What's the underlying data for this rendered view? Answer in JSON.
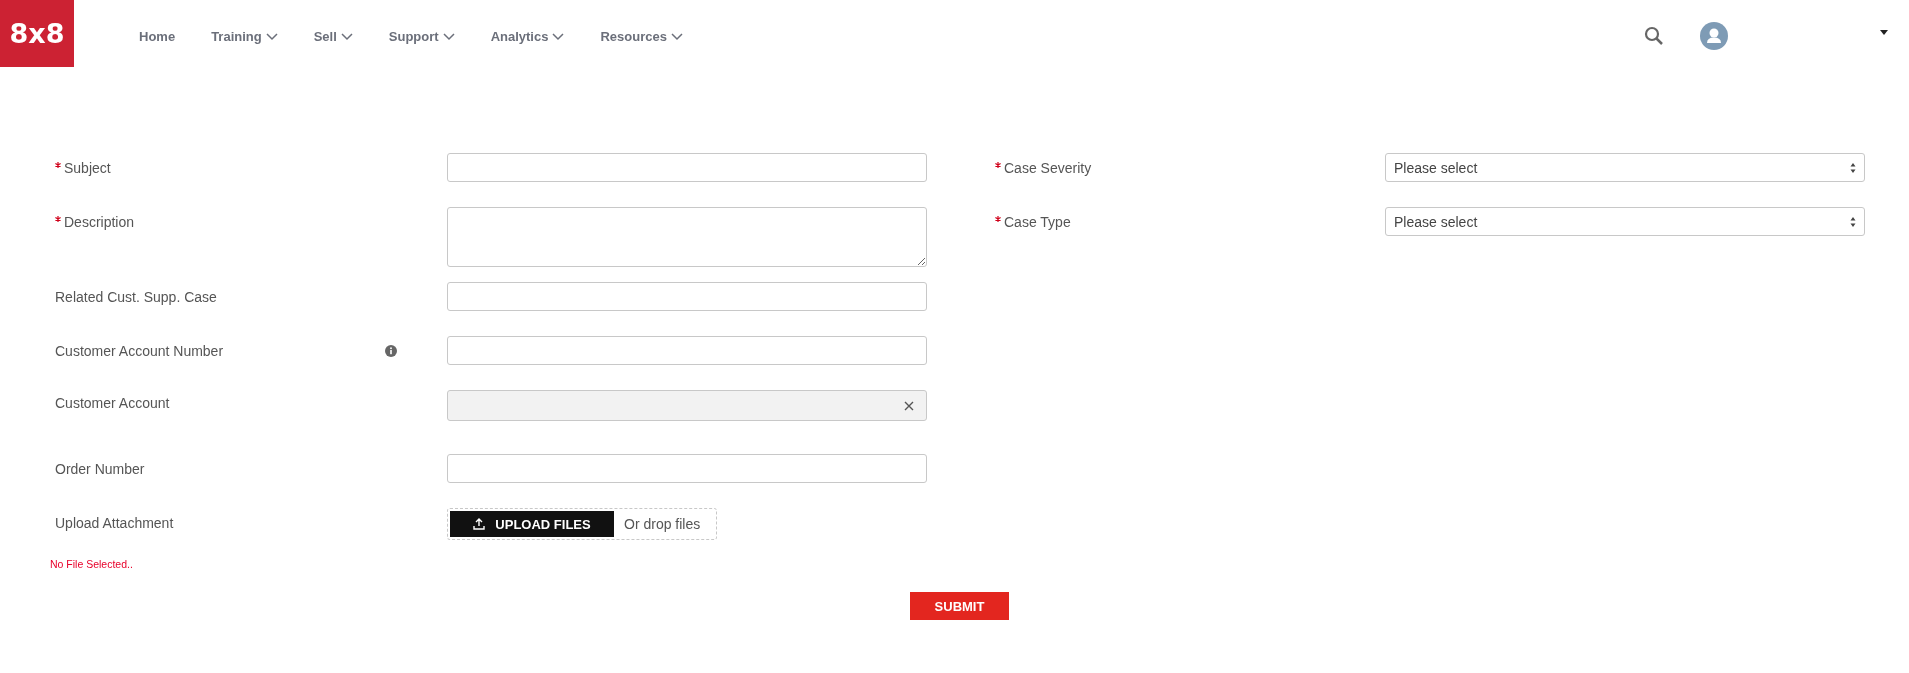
{
  "header": {
    "logo": "8x8",
    "nav": [
      {
        "label": "Home",
        "dropdown": false
      },
      {
        "label": "Training",
        "dropdown": true
      },
      {
        "label": "Sell",
        "dropdown": true
      },
      {
        "label": "Support",
        "dropdown": true
      },
      {
        "label": "Analytics",
        "dropdown": true
      },
      {
        "label": "Resources",
        "dropdown": true
      }
    ]
  },
  "left_fields": [
    {
      "label": "Subject",
      "required": true,
      "kind": "text",
      "info": false
    },
    {
      "label": "Description",
      "required": true,
      "kind": "textarea",
      "info": false
    },
    {
      "label": "Related Cust. Supp. Case",
      "required": false,
      "kind": "text",
      "info": false
    },
    {
      "label": "Customer Account Number",
      "required": false,
      "kind": "text",
      "info": true
    },
    {
      "label": "Customer Account",
      "required": false,
      "kind": "lookup",
      "info": false,
      "disabled": true
    },
    {
      "label": "Order Number",
      "required": false,
      "kind": "text",
      "info": false
    },
    {
      "label": "Upload Attachment",
      "required": false,
      "kind": "upload",
      "info": false,
      "button": "UPLOAD FILES",
      "drop_hint": "Or drop files"
    }
  ],
  "right_fields": [
    {
      "label": "Case Severity",
      "required": true,
      "kind": "select",
      "value": "Please select"
    },
    {
      "label": "Case Type",
      "required": true,
      "kind": "select",
      "value": "Please select"
    }
  ],
  "error": "No File Selected..",
  "submit": "SUBMIT"
}
